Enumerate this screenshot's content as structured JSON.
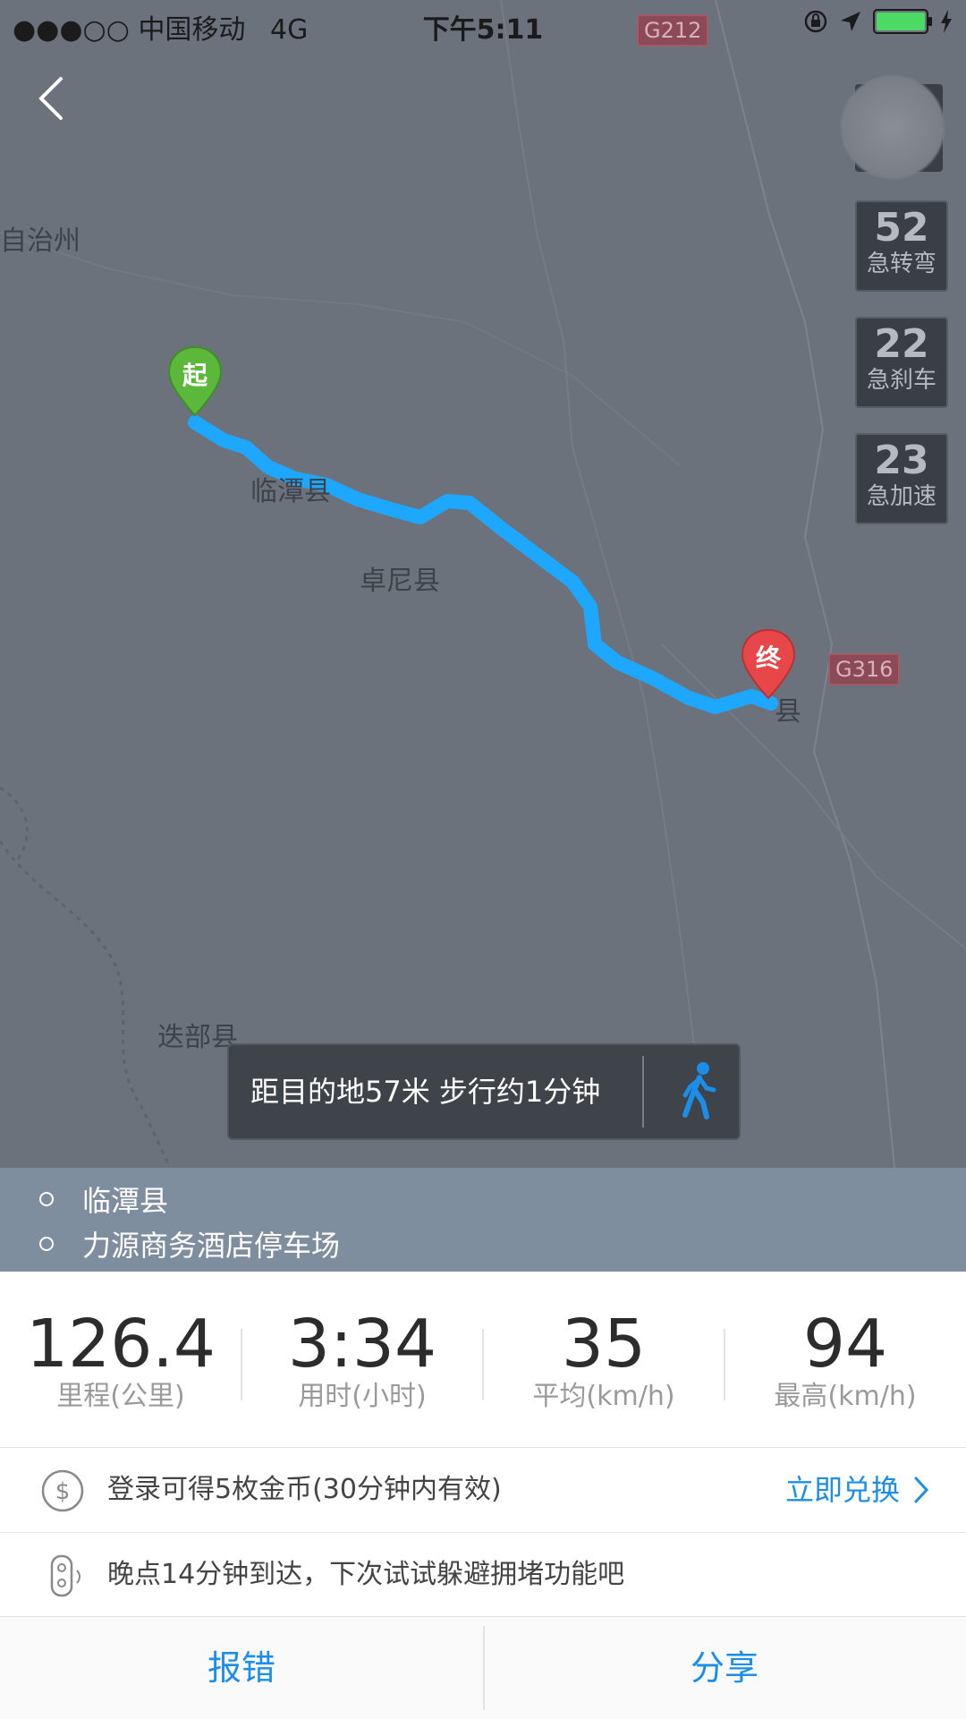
{
  "status_bar": {
    "signal": "●●●○○",
    "carrier": "中国移动",
    "network": "4G",
    "time": "下午5:11",
    "battery_level": 1.0,
    "battery_color": "#4cd964"
  },
  "map": {
    "labels": {
      "region": "自治州",
      "linxian": "临潭县",
      "zhuoni": "卓尼县",
      "diebu": "迭部县",
      "end_county": "县"
    },
    "road_badges": {
      "g212": "G212",
      "g316": "G316"
    },
    "start_marker": "起",
    "end_marker": "终",
    "route_color": "#1ea7ff"
  },
  "driving_stats": [
    {
      "value": "52",
      "label": "急转弯"
    },
    {
      "value": "22",
      "label": "急刹车"
    },
    {
      "value": "23",
      "label": "急加速"
    }
  ],
  "walk_prompt": {
    "text": "距目的地57米 步行约1分钟",
    "icon": "walking-person-icon",
    "icon_color": "#1a8ee8"
  },
  "route": {
    "start": "临潭县",
    "end": "力源商务酒店停车场"
  },
  "metrics": [
    {
      "value": "126.4",
      "label": "里程(公里)"
    },
    {
      "value": "3:34",
      "label": "用时(小时)"
    },
    {
      "value": "35",
      "label": "平均(km/h)"
    },
    {
      "value": "94",
      "label": "最高(km/h)"
    }
  ],
  "coins_row": {
    "icon": "dollar-coin-icon",
    "text": "登录可得5枚金币(30分钟内有效)",
    "link": "立即兑换"
  },
  "traffic_row": {
    "icon": "traffic-light-icon",
    "text": "晚点14分钟到达，下次试试躲避拥堵功能吧"
  },
  "actions": {
    "report": "报错",
    "share": "分享"
  },
  "accent_color": "#1a8ee8"
}
